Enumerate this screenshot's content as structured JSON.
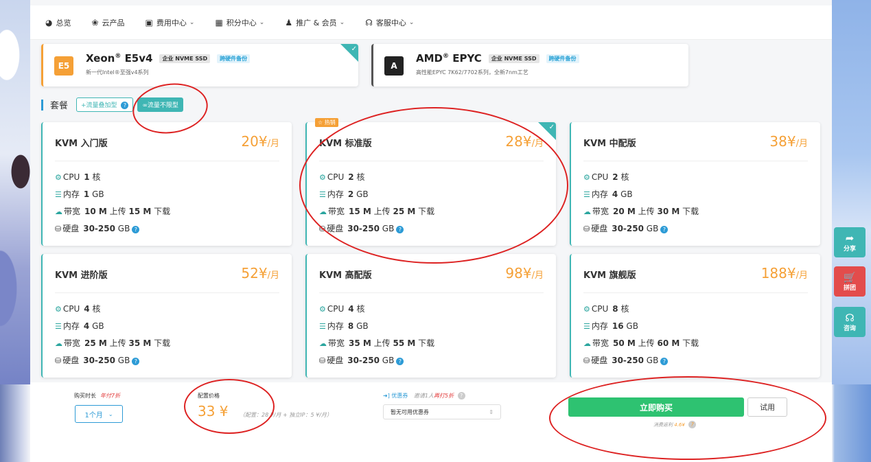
{
  "nav": {
    "items": [
      {
        "icon": "dashboard-icon",
        "glyph": "◕",
        "label": "总览",
        "has_menu": false
      },
      {
        "icon": "cloud-products-icon",
        "glyph": "❀",
        "label": "云产品",
        "has_menu": false
      },
      {
        "icon": "billing-icon",
        "glyph": "▣",
        "label": "费用中心",
        "has_menu": true
      },
      {
        "icon": "gift-icon",
        "glyph": "▦",
        "label": "积分中心",
        "has_menu": true
      },
      {
        "icon": "users-icon",
        "glyph": "♟",
        "label": "推广 & 会员",
        "has_menu": true
      },
      {
        "icon": "headset-icon",
        "glyph": "☊",
        "label": "客服中心",
        "has_menu": true
      }
    ]
  },
  "cpu_options": [
    {
      "badge": "E5",
      "badge_color": "#f5a036",
      "name": "Xeon",
      "reg": "®",
      "model": "E5v4",
      "tags": [
        "企业 NVME SSD",
        "跨硬件备份"
      ],
      "subtitle": "新一代Intel®至强v4系列",
      "selected": true
    },
    {
      "badge": "A",
      "badge_color": "#222222",
      "name": "AMD",
      "reg": "®",
      "model": "EPYC",
      "tags": [
        "企业 NVME SSD",
        "跨硬件备份"
      ],
      "subtitle": "高性能EPYC 7K62/7702系列，全新7nm工艺",
      "selected": false
    }
  ],
  "plan_type": {
    "label": "套餐",
    "options": [
      {
        "label": "+流量叠加型",
        "selected": false
      },
      {
        "label": "∞流量不限型",
        "selected": true
      }
    ]
  },
  "plans": [
    {
      "name": "KVM 入门版",
      "price": "20¥",
      "unit": "/月",
      "cpu": "1",
      "mem": "1",
      "bw_up": "10 M",
      "bw_down": "15 M",
      "disk": "30-250",
      "hot": false,
      "selected": false
    },
    {
      "name": "KVM 标准版",
      "price": "28¥",
      "unit": "/月",
      "cpu": "2",
      "mem": "2",
      "bw_up": "15 M",
      "bw_down": "25 M",
      "disk": "30-250",
      "hot": true,
      "selected": true
    },
    {
      "name": "KVM 中配版",
      "price": "38¥",
      "unit": "/月",
      "cpu": "2",
      "mem": "4",
      "bw_up": "20 M",
      "bw_down": "30 M",
      "disk": "30-250",
      "hot": false,
      "selected": false
    },
    {
      "name": "KVM 进阶版",
      "price": "52¥",
      "unit": "/月",
      "cpu": "4",
      "mem": "4",
      "bw_up": "25 M",
      "bw_down": "35 M",
      "disk": "30-250",
      "hot": false,
      "selected": false
    },
    {
      "name": "KVM 高配版",
      "price": "98¥",
      "unit": "/月",
      "cpu": "4",
      "mem": "8",
      "bw_up": "35 M",
      "bw_down": "55 M",
      "disk": "30-250",
      "hot": false,
      "selected": false
    },
    {
      "name": "KVM 旗舰版",
      "price": "188¥",
      "unit": "/月",
      "cpu": "8",
      "mem": "16",
      "bw_up": "50 M",
      "bw_down": "60 M",
      "disk": "30-250",
      "hot": false,
      "selected": false
    }
  ],
  "spec_labels": {
    "cpu": "CPU",
    "cpu_unit": "核",
    "mem": "内存",
    "mem_unit": "GB",
    "bw": "带宽",
    "up": "上传",
    "down": "下载",
    "disk": "硬盘",
    "disk_unit": "GB",
    "hot_badge": "☆ 热销"
  },
  "side_actions": [
    {
      "label": "分享",
      "icon": "share-icon",
      "glyph": "➦",
      "color": "#3fb6b4"
    },
    {
      "label": "拼团",
      "icon": "cart-icon",
      "glyph": "🛒",
      "color": "#e34c4c"
    },
    {
      "label": "咨询",
      "icon": "headset-icon",
      "glyph": "☊",
      "color": "#3fb6b4"
    }
  ],
  "bottom": {
    "duration_label": "购买时长",
    "duration_promo": "年付7折",
    "duration_value": "1个月",
    "price_label": "配置价格",
    "price_value": "33 ¥",
    "price_note": "（配置：28 ¥/月 + 独立IP：5 ¥/月）",
    "coupon_label": "优惠券",
    "coupon_invite": "邀请1人",
    "coupon_invite_promo": "再打5折",
    "coupon_value": "暂无可用优惠券",
    "buy_label": "立即购买",
    "trial_label": "试用",
    "rebate_label": "消费返利",
    "rebate_value": "4.6¥"
  },
  "colors": {
    "accent": "#3fb6b4",
    "price": "#f5a036",
    "buy": "#2ec271",
    "annotation": "#dd2222"
  }
}
